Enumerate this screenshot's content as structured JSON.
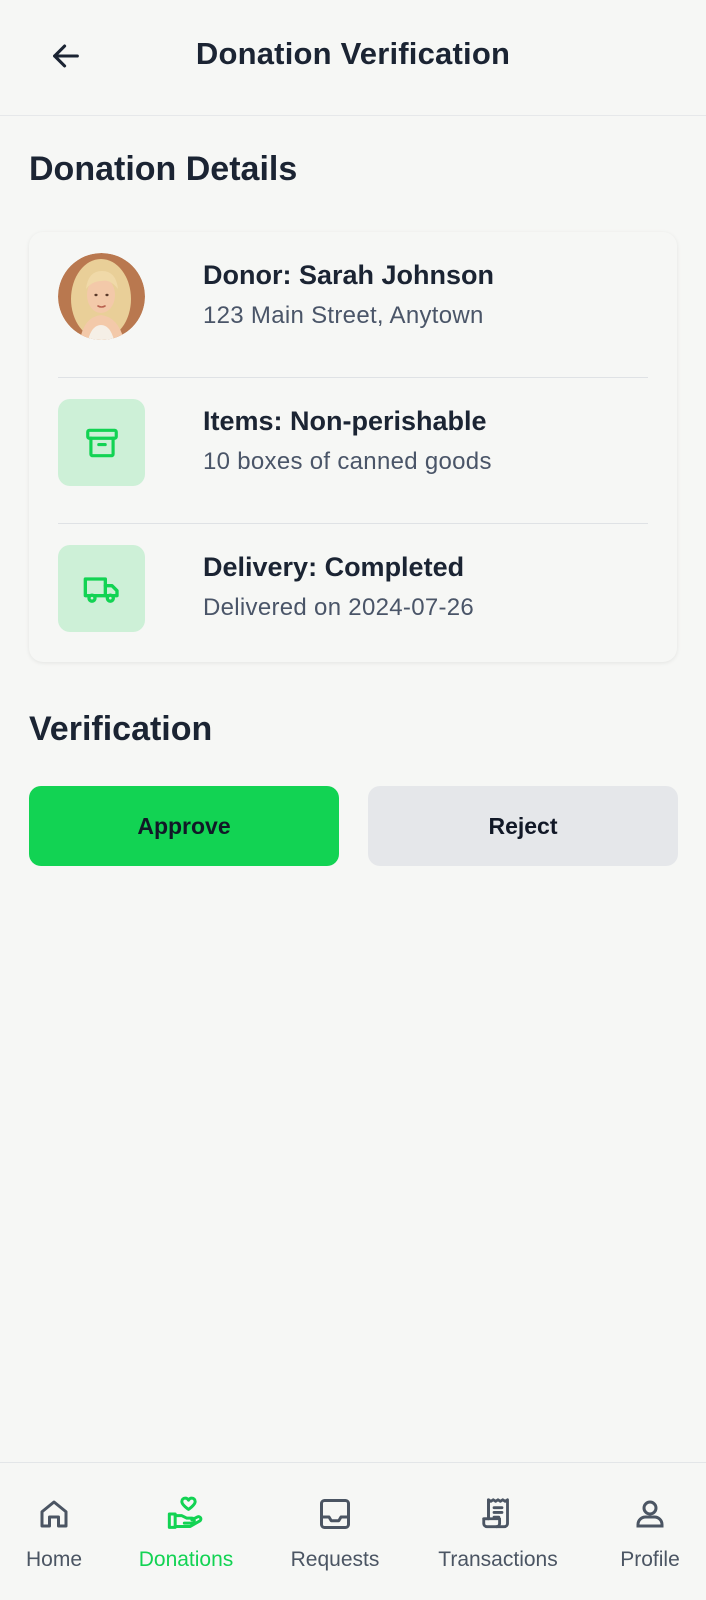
{
  "header": {
    "title": "Donation Verification",
    "back_icon": "arrow-left-icon"
  },
  "details": {
    "section_title": "Donation Details",
    "rows": [
      {
        "icon": "avatar",
        "title": "Donor: Sarah Johnson",
        "subtitle": "123 Main Street, Anytown"
      },
      {
        "icon": "archive-box-icon",
        "title": "Items: Non-perishable",
        "subtitle": "10 boxes of canned goods"
      },
      {
        "icon": "truck-icon",
        "title": "Delivery: Completed",
        "subtitle": "Delivered on 2024-07-26"
      }
    ]
  },
  "verification": {
    "section_title": "Verification",
    "approve_label": "Approve",
    "reject_label": "Reject"
  },
  "nav": {
    "items": [
      {
        "label": "Home",
        "icon": "home-icon",
        "active": false
      },
      {
        "label": "Donations",
        "icon": "hand-heart-icon",
        "active": true
      },
      {
        "label": "Requests",
        "icon": "inbox-icon",
        "active": false
      },
      {
        "label": "Transactions",
        "icon": "receipt-icon",
        "active": false
      },
      {
        "label": "Profile",
        "icon": "user-icon",
        "active": false
      }
    ]
  },
  "colors": {
    "accent": "#12d353",
    "icon_bg": "#cdf0d7",
    "text_dark": "#1b2433",
    "text_muted": "#4a5568",
    "reject_bg": "#e5e7ea"
  }
}
